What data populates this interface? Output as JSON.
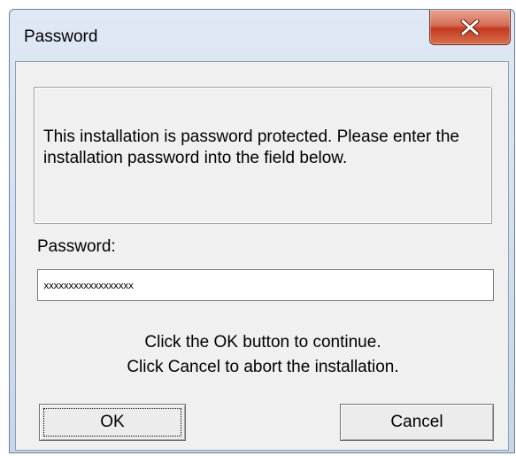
{
  "window": {
    "title": "Password",
    "close_icon": "close-icon"
  },
  "info": {
    "text": "This installation is password protected. Please enter the installation password into the field below."
  },
  "password": {
    "label": "Password:",
    "value": "xxxxxxxxxxxxxxxxxx"
  },
  "hints": {
    "line1": "Click the OK button to continue.",
    "line2": "Click Cancel to abort the installation."
  },
  "buttons": {
    "ok_label": "OK",
    "cancel_label": "Cancel"
  },
  "colors": {
    "close_button": "#c84a33",
    "dialog_background": "#f0f0f0"
  }
}
